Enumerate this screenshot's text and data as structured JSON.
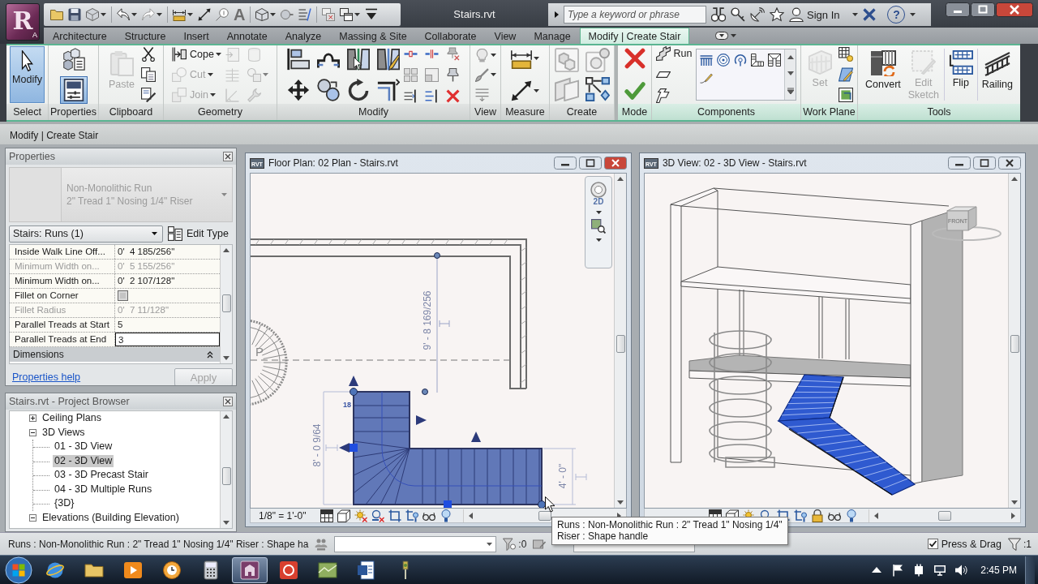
{
  "title_bar": {
    "app_letter": "R",
    "app_key": "A",
    "text_tool": "A",
    "file_name": "Stairs.rvt",
    "search": {
      "placeholder": "Type a keyword or phrase"
    },
    "sign_in": "Sign In",
    "help": "?"
  },
  "ribbon_tabs": [
    {
      "label": "Architecture",
      "selected": false
    },
    {
      "label": "Structure",
      "selected": false
    },
    {
      "label": "Insert",
      "selected": false
    },
    {
      "label": "Annotate",
      "selected": false
    },
    {
      "label": "Analyze",
      "selected": false
    },
    {
      "label": "Massing & Site",
      "selected": false
    },
    {
      "label": "Collaborate",
      "selected": false
    },
    {
      "label": "View",
      "selected": false
    },
    {
      "label": "Manage",
      "selected": false
    },
    {
      "label": "Modify | Create Stair",
      "selected": true
    }
  ],
  "ribbon_panels": [
    {
      "title": "Select",
      "tools": [
        {
          "label": "Modify",
          "selected": true
        }
      ]
    },
    {
      "title": "Properties",
      "tools": [
        {
          "selected": false
        },
        {
          "selected": true
        }
      ]
    },
    {
      "title": "Clipboard",
      "tools": [
        {
          "label": "Paste",
          "disabled": true
        }
      ]
    },
    {
      "title": "Geometry",
      "tools": [
        {
          "label": "Cope",
          "disabled": false
        },
        {
          "label": "Cut",
          "disabled": true
        },
        {
          "label": "Join",
          "disabled": true
        }
      ]
    },
    {
      "title": "Modify"
    },
    {
      "title": "View"
    },
    {
      "title": "Measure"
    },
    {
      "title": "Create"
    },
    {
      "title": "Mode"
    },
    {
      "title": "Components",
      "tools": [
        {
          "label": "Run",
          "disabled": false
        }
      ]
    },
    {
      "title": "Work Plane",
      "tools": [
        {
          "label": "Set",
          "disabled": true
        }
      ]
    },
    {
      "title": "Tools",
      "tools": [
        {
          "label": "Convert",
          "disabled": false
        },
        {
          "label": "Edit Sketch",
          "disabled": true
        },
        {
          "label": "Flip",
          "disabled": false
        },
        {
          "label": "Railing",
          "disabled": false
        }
      ]
    }
  ],
  "options_bar": {
    "title": "Modify | Create Stair"
  },
  "properties": {
    "title": "Properties",
    "type_name": "Non-Monolithic Run",
    "type_detail": "2\" Tread 1\" Nosing 1/4\" Riser",
    "selector": "Stairs: Runs (1)",
    "edit_type": "Edit Type",
    "rows": [
      {
        "kind": "text",
        "name": "Inside Walk Line Off...",
        "value": "0'  4 185/256\"",
        "disabled": false,
        "selected": false
      },
      {
        "kind": "text",
        "name": "Minimum Width on...",
        "value": "0'  5 155/256\"",
        "disabled": true,
        "selected": false
      },
      {
        "kind": "text",
        "name": "Minimum Width on...",
        "value": "0'  2 107/128\"",
        "disabled": false,
        "selected": false
      },
      {
        "kind": "checkbox",
        "name": "Fillet on Corner",
        "checked": false,
        "disabled": false
      },
      {
        "kind": "text",
        "name": "Fillet Radius",
        "value": "0'  7 11/128\"",
        "disabled": true,
        "selected": false
      },
      {
        "kind": "text",
        "name": "Parallel Treads at Start",
        "value": "5",
        "disabled": false,
        "selected": false
      },
      {
        "kind": "text",
        "name": "Parallel Treads at End",
        "value": "3",
        "disabled": false,
        "selected": true
      }
    ],
    "group": {
      "label": "Dimensions",
      "expanded": true
    },
    "help_link": "Properties help",
    "apply": {
      "label": "Apply",
      "disabled": true
    }
  },
  "project_browser": {
    "title": "Stairs.rvt - Project Browser",
    "items": [
      {
        "label": "Ceiling Plans",
        "expanded": false,
        "selected": false
      },
      {
        "label": "3D Views",
        "expanded": true,
        "selected": false,
        "children": [
          {
            "label": "01 - 3D View",
            "selected": false
          },
          {
            "label": "02 - 3D View",
            "selected": true
          },
          {
            "label": "03 - 3D Precast Stair",
            "selected": false
          },
          {
            "label": "04 - 3D Multiple Runs",
            "selected": false
          },
          {
            "label": "{3D}",
            "selected": false
          }
        ]
      },
      {
        "label": "Elevations (Building Elevation)",
        "expanded": true,
        "selected": false
      }
    ]
  },
  "views": [
    {
      "kind": "plan",
      "doc_icon": "RVT",
      "title": "Floor Plan: 02 Plan - Stairs.rvt",
      "selected": true,
      "scale": "1/8\" = 1'-0\"",
      "nav_label": "2D",
      "labels": {
        "up": "P",
        "tread_count": "18",
        "dim_vertical": "9' - 8 169/256",
        "dim_left": "8' - 0 9/64",
        "dim_right": "4' - 0\""
      }
    },
    {
      "kind": "perspective",
      "doc_icon": "RVT",
      "title": "3D View: 02 - 3D View - Stairs.rvt",
      "selected": false,
      "cube_label": "FRONT"
    }
  ],
  "tooltip": {
    "lines": [
      "Runs : Non-Monolithic Run : 2\" Tread 1\" Nosing 1/4\"",
      "Riser : Shape handle"
    ]
  },
  "status_bar": {
    "message": "Runs : Non-Monolithic Run : 2\" Tread 1\" Nosing 1/4\" Riser : Shape ha",
    "filter_count": ":0",
    "press_drag": {
      "label": "Press & Drag",
      "checked": true
    },
    "selection_count": ":1"
  },
  "taskbar": {
    "apps": [
      {
        "selected": false
      },
      {
        "selected": false
      },
      {
        "selected": false
      },
      {
        "selected": false
      },
      {
        "selected": false
      },
      {
        "selected": true
      },
      {
        "selected": false
      },
      {
        "selected": false
      },
      {
        "selected": false
      },
      {
        "selected": false
      }
    ],
    "time": "2:45 PM"
  }
}
